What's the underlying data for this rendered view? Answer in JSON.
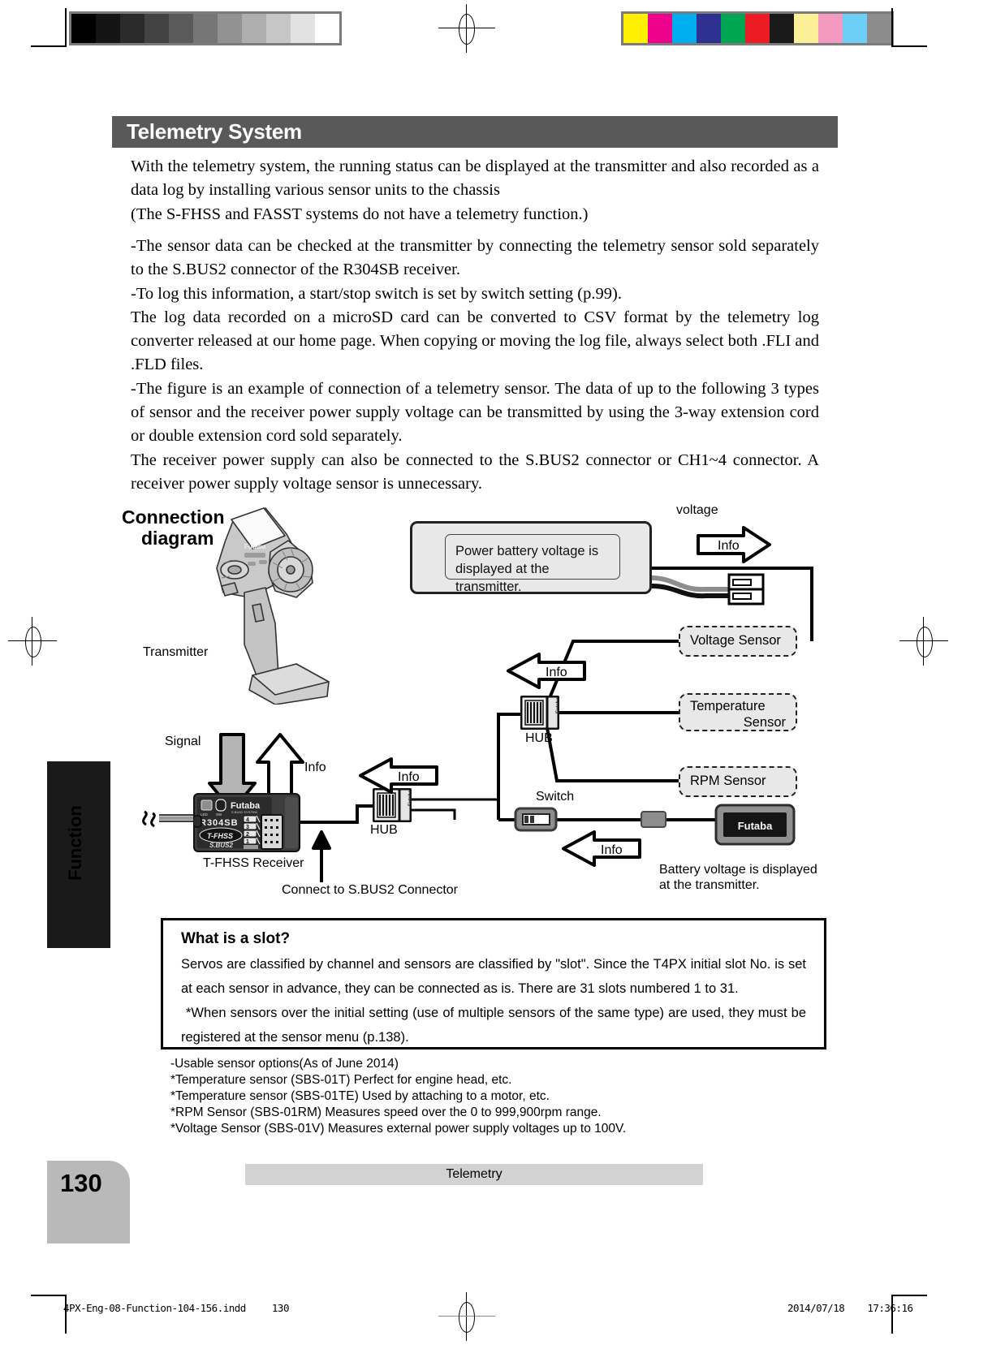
{
  "header": {
    "title": "Telemetry System"
  },
  "body_paragraphs": [
    "With the telemetry system, the running status can be displayed at the transmitter and also recorded as a data log by installing various sensor units to the chassis",
    " (The S-FHSS and FASST systems do not have a telemetry function.)",
    "-The sensor data can be checked at the transmitter by connecting the telemetry sensor sold separately to the S.BUS2 connector of the R304SB receiver.",
    "-To log this information, a start/stop switch is set by switch setting (p.99).",
    "The log data recorded on a microSD card can be converted to CSV format by the telemetry log converter released at our home page. When copying or moving the log file, always select both .FLI and .FLD files.",
    "-The figure is an example of connection of a telemetry sensor. The data of up to the following 3 types of sensor and the receiver power supply voltage can be transmitted by using the 3-way extension cord or double extension cord sold separately.",
    "The receiver power supply can also be connected to the S.BUS2 connector or CH1~4 connector. A receiver power supply voltage sensor is unnecessary."
  ],
  "side_tab": {
    "label": "Function"
  },
  "diagram": {
    "title_line1": "Connection",
    "title_line2": "diagram",
    "transmitter_label": "Transmitter",
    "power_note": "Power battery voltage is displayed at the transmitter.",
    "voltage_label": "voltage",
    "info_label": "Info",
    "signal_label": "Signal",
    "hub_label": "HUB",
    "switch_label": "Switch",
    "receiver_label": "T-FHSS Receiver",
    "connect_label": "Connect to S.BUS2 Connector",
    "battery_note": "Battery voltage is displayed at the transmitter.",
    "receiver_model": "R304SB",
    "receiver_brand": "Futaba",
    "receiver_system": "T-FHSS",
    "receiver_bus": "S.BUS2",
    "receiver_led": "LED",
    "receiver_sw": "SW",
    "receiver_channels": [
      "4",
      "3",
      "2",
      "1"
    ],
    "hub_brand": "Futaba",
    "battery_brand": "Futaba",
    "sensors": [
      {
        "line1": "Voltage Sensor",
        "line2": ""
      },
      {
        "line1": "Temperature",
        "line2": "Sensor"
      },
      {
        "line1": "RPM Sensor",
        "line2": ""
      }
    ]
  },
  "slot_box": {
    "title": "What is a slot?",
    "paragraphs": [
      "Servos are classified by channel and sensors are classified by \"slot\". Since the T4PX initial slot No. is set at each sensor in advance, they can be connected as is. There are 31 slots numbered 1 to 31.",
      "*When sensors over the initial setting (use of multiple sensors of the same type) are used, they must be registered at the sensor menu (p.138)."
    ]
  },
  "footnotes": [
    "-Usable sensor options(As of June 2014)",
    "*Temperature sensor (SBS-01T) Perfect for engine head, etc.",
    "*Temperature sensor (SBS-01TE) Used by attaching to a motor, etc.",
    "*RPM Sensor (SBS-01RM) Measures speed over the 0 to 999,900rpm range.",
    "*Voltage Sensor (SBS-01V) Measures external power supply voltages up to 100V."
  ],
  "footer": {
    "page_number": "130",
    "section_label": "Telemetry",
    "file_name": "4PX-Eng-08-Function-104-156.indd",
    "file_page": "130",
    "print_date": "2014/07/18",
    "print_time": "17:36:16"
  },
  "print_marks": {
    "grayscale_swatches": [
      "#000000",
      "#141414",
      "#2b2b2b",
      "#434343",
      "#5a5a5a",
      "#767676",
      "#929292",
      "#aeaeae",
      "#c6c6c6",
      "#e2e2e2",
      "#ffffff"
    ],
    "color_swatches": [
      "#fff000",
      "#ec008c",
      "#00aeef",
      "#2e3192",
      "#00a651",
      "#ed1c24",
      "#1a1a1a",
      "#fbf098",
      "#f49ac1",
      "#6dcff6",
      "#8c8c8c"
    ]
  }
}
